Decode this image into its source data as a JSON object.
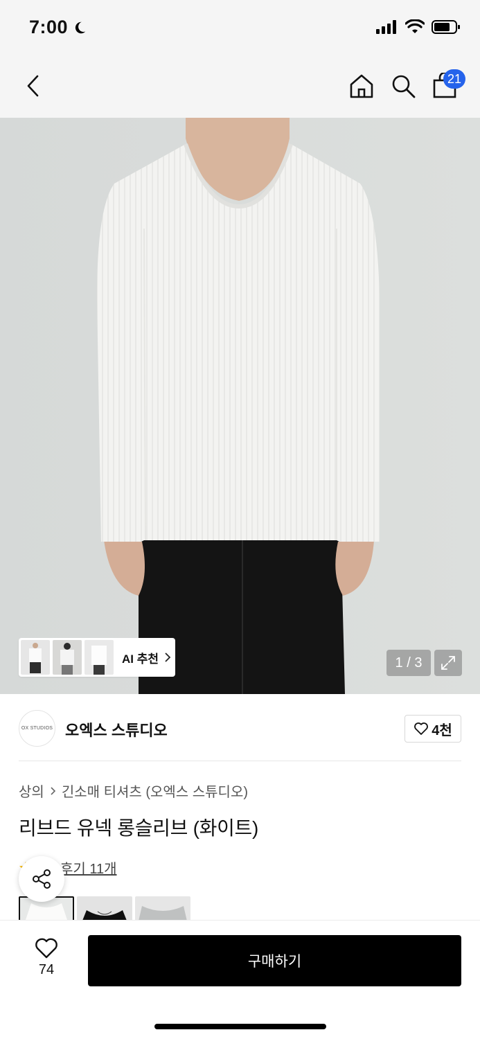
{
  "status_bar": {
    "time": "7:00"
  },
  "nav": {
    "cart_count": "21"
  },
  "hero": {
    "ai_label": "AI 추천",
    "page_indicator": "1 / 3"
  },
  "brand": {
    "logo_text": "OX STUDIOS",
    "name": "오엑스 스튜디오",
    "likes": "4천"
  },
  "product": {
    "breadcrumb": [
      "상의",
      "긴소매 티셔츠 (오엑스 스튜디오)"
    ],
    "title": "리브드 유넥 롱슬리브 (화이트)",
    "review_text": "후기 11개"
  },
  "colors": [
    "white",
    "black",
    "gray"
  ],
  "bottom": {
    "like_count": "74",
    "buy_label": "구매하기"
  }
}
